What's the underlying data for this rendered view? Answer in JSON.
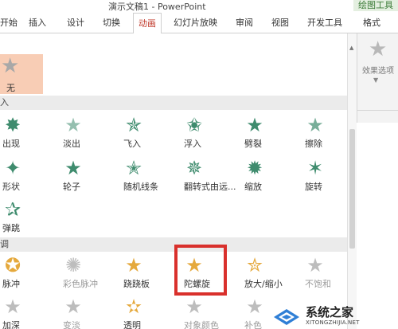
{
  "window": {
    "title": "演示文稿1 - PowerPoint",
    "context_tab": "绘图工具"
  },
  "ribbon_tabs": [
    "开始",
    "插入",
    "设计",
    "切换",
    "动画",
    "幻灯片放映",
    "审阅",
    "视图",
    "开发工具",
    "格式"
  ],
  "active_tab": "动画",
  "ribbon_right": {
    "effect_options_label": "效果选项",
    "dropdown_icon": "chevron-down-icon"
  },
  "gallery": {
    "none_label": "无",
    "sections": [
      {
        "title": "入",
        "items": [
          {
            "label": "出现",
            "icon": "star-burst-icon"
          },
          {
            "label": "淡出",
            "icon": "star-fade-icon"
          },
          {
            "label": "飞入",
            "icon": "star-flyin-icon"
          },
          {
            "label": "浮入",
            "icon": "star-float-icon"
          },
          {
            "label": "劈裂",
            "icon": "star-split-icon"
          },
          {
            "label": "擦除",
            "icon": "star-wipe-icon"
          },
          {
            "label": "形状",
            "icon": "star-shape-icon"
          },
          {
            "label": "轮子",
            "icon": "star-wheel-icon"
          },
          {
            "label": "随机线条",
            "icon": "star-lines-icon"
          },
          {
            "label": "翻转式由远...",
            "icon": "star-flip-icon"
          },
          {
            "label": "缩放",
            "icon": "star-zoom-icon"
          },
          {
            "label": "旋转",
            "icon": "star-swivel-icon"
          },
          {
            "label": "弹跳",
            "icon": "star-bounce-icon"
          }
        ]
      },
      {
        "title": "调",
        "items": [
          {
            "label": "脉冲",
            "icon": "star-pulse-icon"
          },
          {
            "label": "彩色脉冲",
            "icon": "star-color-pulse-icon"
          },
          {
            "label": "跷跷板",
            "icon": "star-teeter-icon"
          },
          {
            "label": "陀螺旋",
            "icon": "star-spin-icon"
          },
          {
            "label": "放大/缩小",
            "icon": "star-grow-icon"
          },
          {
            "label": "不饱和",
            "icon": "star-desaturate-icon"
          },
          {
            "label": "加深",
            "icon": "star-darken-icon"
          },
          {
            "label": "变淡",
            "icon": "star-lighten-icon"
          },
          {
            "label": "透明",
            "icon": "star-transparency-icon"
          },
          {
            "label": "对象颜色",
            "icon": "star-object-color-icon"
          },
          {
            "label": "补色",
            "icon": "star-complementary-icon"
          }
        ]
      }
    ]
  },
  "highlighted_item": "陀螺旋",
  "watermark": {
    "main": "系统之家",
    "sub": "XITONGZHIJIA.NET"
  },
  "colors": {
    "entrance_icon": "#3f8c6e",
    "emphasis_icon": "#e5a93d",
    "disabled_icon": "#bdbdbd",
    "selected_tile": "#f8cdb5",
    "active_tab_text": "#c0392b",
    "highlight_box": "#d9302c"
  }
}
